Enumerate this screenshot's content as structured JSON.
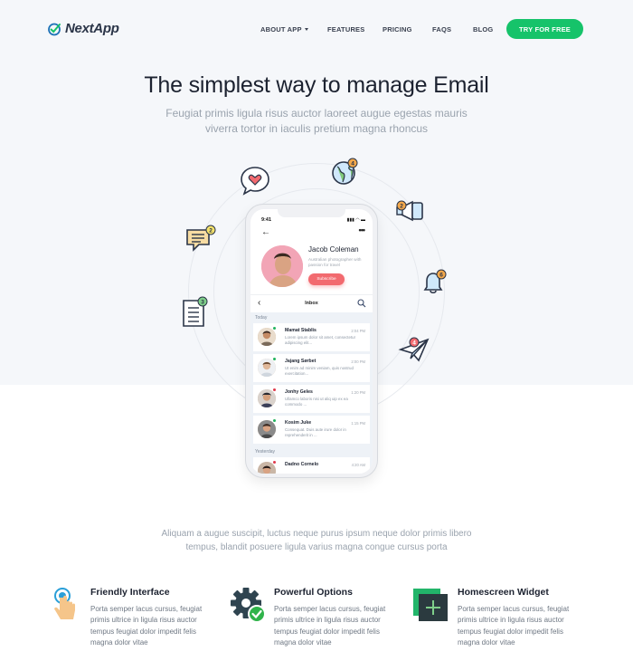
{
  "nav": {
    "brand": "NextApp",
    "items": [
      "ABOUT APP",
      "FEATURES",
      "PRICING",
      "FAQS",
      "BLOG"
    ],
    "cta": "TRY FOR FREE"
  },
  "hero": {
    "title": "The simplest way to manage Email",
    "subtitle": "Feugiat primis ligula risus auctor laoreet augue egestas mauris viverra tortor in iaculis pretium magna rhoncus"
  },
  "phone": {
    "time": "9:41",
    "profile_name": "Jacob Coleman",
    "profile_desc": "Australian photographer with passion for travel",
    "subscribe": "Subscribe",
    "inbox_title": "Inbox",
    "today": "Today",
    "yesterday": "Yesterday",
    "emails": [
      {
        "name": "Mamat Stablis",
        "time": "2:04 PM",
        "preview": "Lorem ipsum dolor sit amet, consectetur adipiscing elit...",
        "status_color": "#22b35e"
      },
      {
        "name": "Jajang Sørbet",
        "time": "2:00 PM",
        "preview": "Ut enim ad minim veniam, quis nostrud exercitation...",
        "status_color": "#22b35e"
      },
      {
        "name": "Jonhy Geles",
        "time": "1:20 PM",
        "preview": "Ullamco laboris nisi ut aliq uip ex ea commodo ...",
        "status_color": "#e0384a"
      },
      {
        "name": "Kosim Juke",
        "time": "1:15 PM",
        "preview": "Consequat. Duis aute irure dolor in reprehenderit in ...",
        "status_color": "#22b35e"
      },
      {
        "name": "Dadno Cornelo",
        "time": "4:20 AM",
        "preview": "",
        "status_color": "#e0384a"
      }
    ]
  },
  "floating_badges": {
    "globe": "4",
    "megaphone": "2",
    "bell": "6",
    "plane": "4",
    "chat": "2",
    "note": "3"
  },
  "tagline": "Aliquam a augue suscipit, luctus neque purus ipsum neque dolor primis libero tempus, blandit posuere ligula varius magna congue cursus porta",
  "features": [
    {
      "title": "Friendly Interface",
      "desc": "Porta semper lacus cursus, feugiat primis ultrice in ligula risus auctor tempus feugiat dolor impedit felis magna dolor vitae",
      "icon": "touch-icon"
    },
    {
      "title": "Powerful Options",
      "desc": "Porta semper lacus cursus, feugiat primis ultrice in ligula risus auctor tempus feugiat dolor impedit felis magna dolor vitae",
      "icon": "gear-check-icon"
    },
    {
      "title": "Homescreen Widget",
      "desc": "Porta semper lacus cursus, feugiat primis ultrice in ligula risus auctor tempus feugiat dolor impedit felis magna dolor vitae",
      "icon": "widget-plus-icon"
    }
  ],
  "colors": {
    "accent": "#16c36a",
    "subscribe": "#f26a6f",
    "brand_blue": "#1f73b7"
  }
}
